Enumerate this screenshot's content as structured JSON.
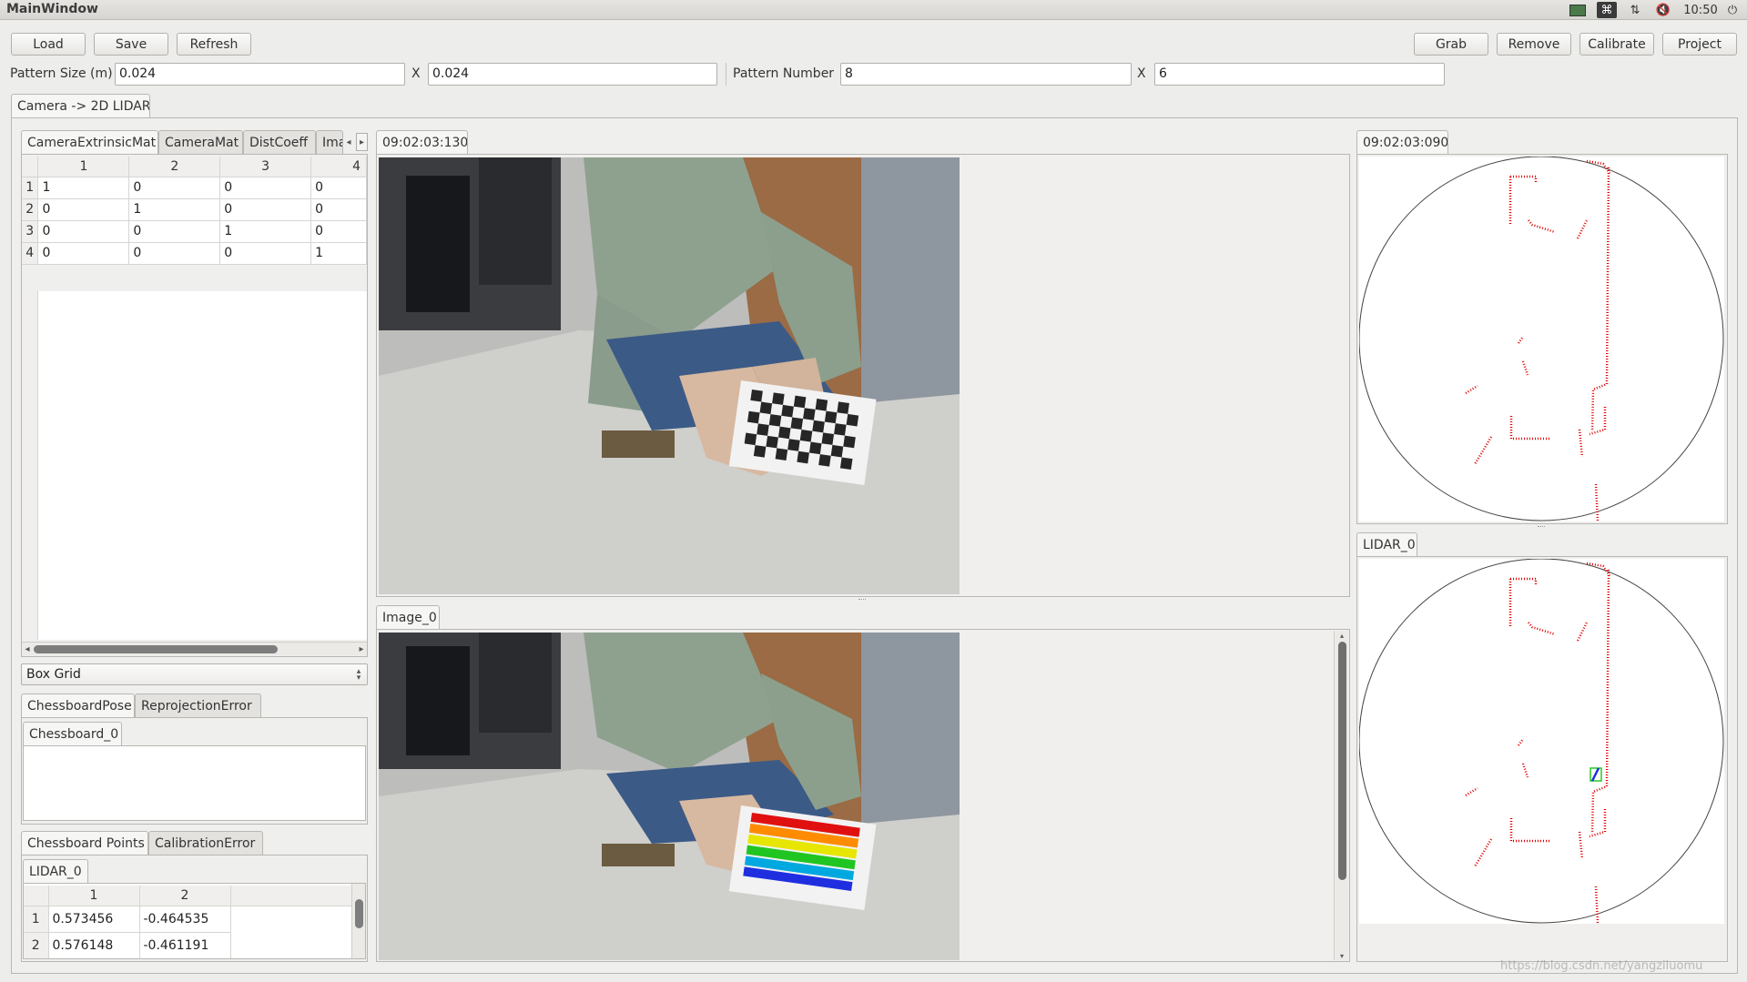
{
  "window": {
    "title": "MainWindow",
    "clock": "10:50"
  },
  "toolbar": {
    "load": "Load",
    "save": "Save",
    "refresh": "Refresh",
    "grab": "Grab",
    "remove": "Remove",
    "calibrate": "Calibrate",
    "project": "Project"
  },
  "params": {
    "pattern_size_label": "Pattern Size (m)",
    "pattern_size_x": "0.024",
    "pattern_size_y": "0.024",
    "pattern_number_label": "Pattern Number",
    "pattern_number_x": "8",
    "pattern_number_y": "6",
    "x_label": "X"
  },
  "main_tab": "Camera -> 2D LIDAR",
  "matrix_tabs": [
    "CameraExtrinsicMat",
    "CameraMat",
    "DistCoeff",
    "Ima"
  ],
  "matrix": {
    "headers": [
      "1",
      "2",
      "3",
      "4"
    ],
    "rows": [
      [
        "1",
        "1",
        "0",
        "0",
        "0"
      ],
      [
        "2",
        "0",
        "1",
        "0",
        "0"
      ],
      [
        "3",
        "0",
        "0",
        "1",
        "0"
      ],
      [
        "4",
        "0",
        "0",
        "0",
        "1"
      ]
    ]
  },
  "view_select": "Box Grid",
  "pose_tabs": [
    "ChessboardPose",
    "ReprojectionError"
  ],
  "pose_subtab": "Chessboard_0",
  "points_tabs": [
    "Chessboard Points",
    "CalibrationError"
  ],
  "points_subtab": "LIDAR_0",
  "points": {
    "headers": [
      "1",
      "2"
    ],
    "rows": [
      [
        "1",
        "0.573456",
        "-0.464535"
      ],
      [
        "2",
        "0.576148",
        "-0.461191"
      ]
    ]
  },
  "camera_live_tab": "09:02:03:130",
  "camera_capture_tab": "Image_0",
  "lidar_live_tab": "09:02:03:090",
  "lidar_capture_tab": "LIDAR_0",
  "watermark": "https://blog.csdn.net/yangziluomu",
  "colors": {
    "window_bg": "#ededec",
    "lidar_points": "#e00000",
    "chessboard_dark": "#262626"
  }
}
